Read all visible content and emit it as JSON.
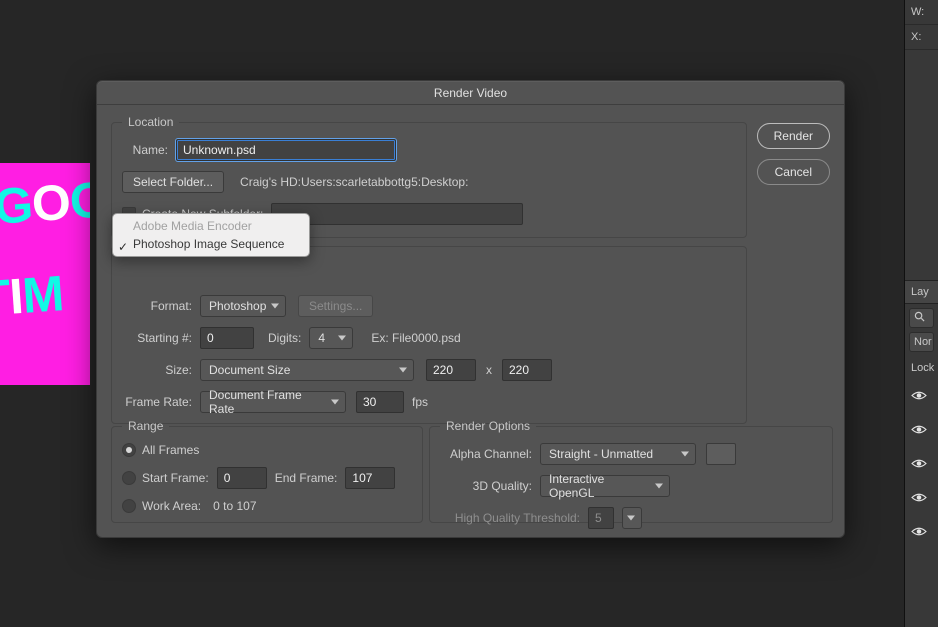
{
  "dialog": {
    "title": "Render Video",
    "render_button": "Render",
    "cancel_button": "Cancel"
  },
  "location": {
    "legend": "Location",
    "name_label": "Name:",
    "name_value": "Unknown.psd",
    "select_folder_button": "Select Folder...",
    "path_text": "Craig's HD:Users:scarletabbottg5:Desktop:",
    "create_subfolder_label": "Create New Subfolder:",
    "create_subfolder_value": ""
  },
  "encoder": {
    "popup_items": [
      "Adobe Media Encoder",
      "Photoshop Image Sequence"
    ],
    "popup_checked_index": 1,
    "format_label": "Format:",
    "format_value": "Photoshop",
    "settings_button": "Settings...",
    "starting_label": "Starting #:",
    "starting_value": "0",
    "digits_label": "Digits:",
    "digits_value": "4",
    "example_label": "Ex: File0000.psd",
    "size_label": "Size:",
    "size_preset_value": "Document Size",
    "size_w": "220",
    "size_x": "x",
    "size_h": "220",
    "frame_rate_label": "Frame Rate:",
    "frame_rate_preset": "Document Frame Rate",
    "frame_rate_value": "30",
    "frame_rate_unit": "fps"
  },
  "range": {
    "legend": "Range",
    "all_frames_label": "All Frames",
    "start_frame_label": "Start Frame:",
    "start_value": "0",
    "end_frame_label": "End Frame:",
    "end_value": "107",
    "work_area_label": "Work Area:",
    "work_area_value": "0 to 107",
    "selected": "all"
  },
  "render_options": {
    "legend": "Render Options",
    "alpha_label": "Alpha Channel:",
    "alpha_value": "Straight - Unmatted",
    "quality3d_label": "3D Quality:",
    "quality3d_value": "Interactive OpenGL",
    "hq_threshold_label": "High Quality Threshold:",
    "hq_threshold_value": "5"
  },
  "right_panel": {
    "w_label": "W:",
    "x_label": "X:",
    "layers_label": "Lay",
    "normal_label": "Nor",
    "lock_label": "Lock"
  },
  "preview": {
    "line1_a": "G",
    "line1_b": "O",
    "line1_c": "O",
    "line2_a": "T",
    "line2_b": "I",
    "line2_c": "M"
  }
}
